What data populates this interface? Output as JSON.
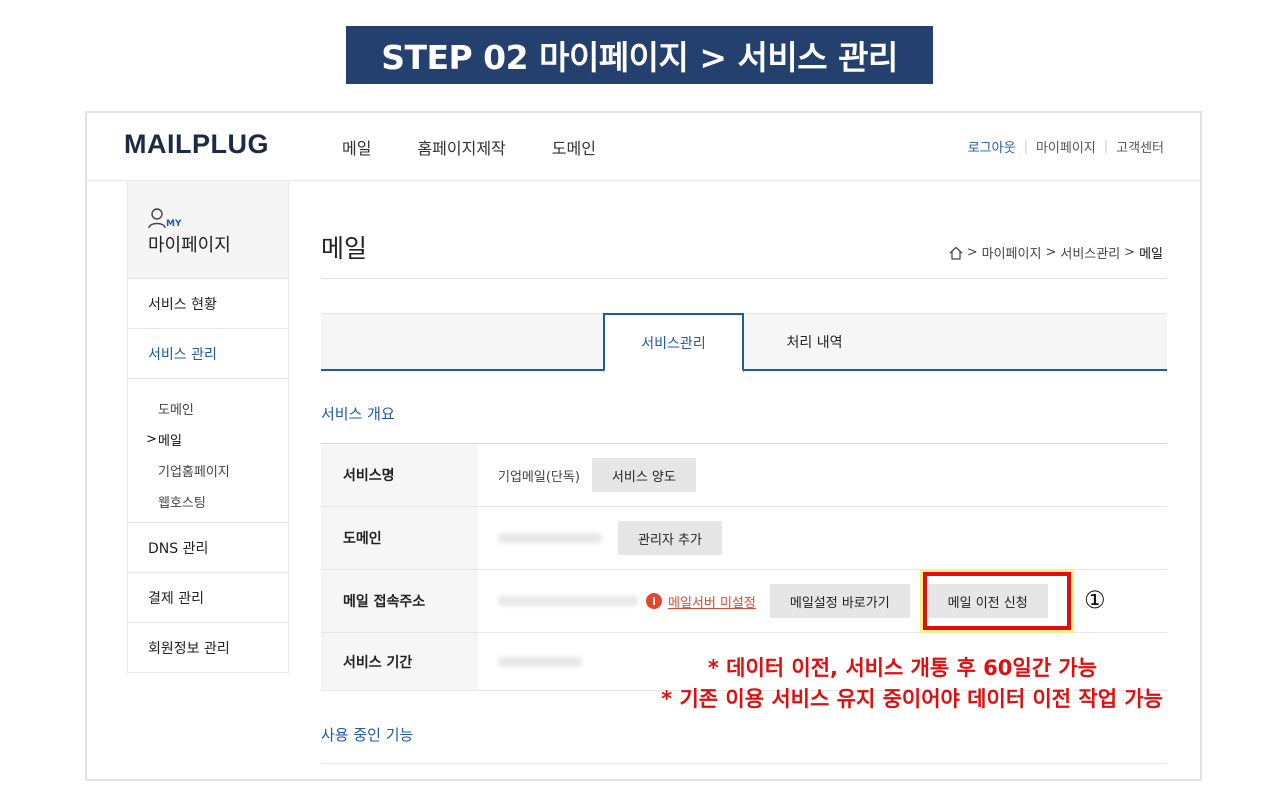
{
  "banner": {
    "text": "STEP 02 마이페이지 > 서비스 관리"
  },
  "header": {
    "logo": "MAILPLUG",
    "nav": [
      "메일",
      "홈페이지제작",
      "도메인"
    ],
    "util": {
      "logout": "로그아웃",
      "mypage": "마이페이지",
      "support": "고객센터",
      "separator": "|"
    }
  },
  "sidebar": {
    "my_badge": "MY",
    "title": "마이페이지",
    "items": [
      {
        "label": "서비스 현황"
      },
      {
        "label": "서비스 관리"
      },
      {
        "label": "DNS 관리"
      },
      {
        "label": "결제 관리"
      },
      {
        "label": "회원정보 관리"
      }
    ],
    "sub_items": [
      "도메인",
      "메일",
      "기업홈페이지",
      "웹호스팅"
    ]
  },
  "main": {
    "title": "메일",
    "breadcrumb": [
      "마이페이지",
      "서비스관리",
      "메일"
    ],
    "breadcrumb_sep": ">",
    "tabs": [
      "서비스관리",
      "처리 내역"
    ],
    "section_overview": "서비스 개요",
    "section_features": "사용 중인 기능",
    "rows": {
      "service_name": {
        "label": "서비스명",
        "value": "기업메일(단독)",
        "button": "서비스 양도"
      },
      "domain": {
        "label": "도메인",
        "button": "관리자 추가"
      },
      "mail_access": {
        "label": "메일 접속주소",
        "warning": "메일서버 미설정",
        "button1": "메일설정 바로가기",
        "button2": "메일 이전 신청"
      },
      "period": {
        "label": "서비스 기간"
      }
    }
  },
  "annotation": {
    "marker": "①",
    "notes": [
      "* 데이터 이전, 서비스 개통 후 60일간 가능",
      "* 기존 이용 서비스 유지 중이어야 데이터 이전 작업 가능"
    ],
    "color": "#e20d0d"
  },
  "colors": {
    "banner_bg": "#24406e",
    "accent": "#1d5aa8",
    "warning": "#e2462e"
  }
}
